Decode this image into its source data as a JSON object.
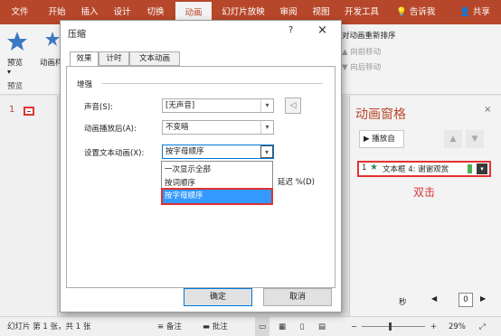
{
  "ribbon_tabs": [
    {
      "label": "文件"
    },
    {
      "label": "开始"
    },
    {
      "label": "插入"
    },
    {
      "label": "设计"
    },
    {
      "label": "切换"
    },
    {
      "label": "动画"
    },
    {
      "label": "幻灯片放映"
    },
    {
      "label": "审阅"
    },
    {
      "label": "视图"
    },
    {
      "label": "开发工具"
    }
  ],
  "tell_me": "告诉我",
  "share": "共享",
  "ribbon": {
    "preview_label": "预览",
    "animation_label": "动画样",
    "preview_group": "预览",
    "reorder_title": "对动画重新排序",
    "move_earlier": "向前移动",
    "move_later": "向后移动"
  },
  "slide_thumb_number": "1",
  "dialog": {
    "title": "压缩",
    "help": "?",
    "close": "×",
    "tabs": [
      {
        "label": "效果"
      },
      {
        "label": "计时"
      },
      {
        "label": "文本动画"
      }
    ],
    "section_title": "增强",
    "sound_label": "声音(S):",
    "sound_value": "[无声音]",
    "after_anim_label": "动画播放后(A):",
    "after_anim_value": "不变暗",
    "text_anim_label": "设置文本动画(X):",
    "text_anim_value": "按字母顺序",
    "dropdown_options": [
      "一次显示全部",
      "按词顺序",
      "按字母顺序"
    ],
    "delay_label": "延迟 %(D)",
    "ok_label": "确定",
    "cancel_label": "取消"
  },
  "anim_pane": {
    "title": "动画窗格",
    "play_label": "播放自",
    "item_number": "1",
    "item_label": "文本框 4: 谢谢观赏",
    "annotation": "双击",
    "seconds_label": "秒",
    "counter_value": "0"
  },
  "statusbar": {
    "slide_info": "幻灯片 第 1 张，共 1 张",
    "notes": "备注",
    "comments": "批注",
    "zoom": "29%"
  },
  "colors": {
    "accent": "#b7472a",
    "highlight": "#e23232",
    "selection": "#3399ff",
    "star": "#2e8b57"
  }
}
